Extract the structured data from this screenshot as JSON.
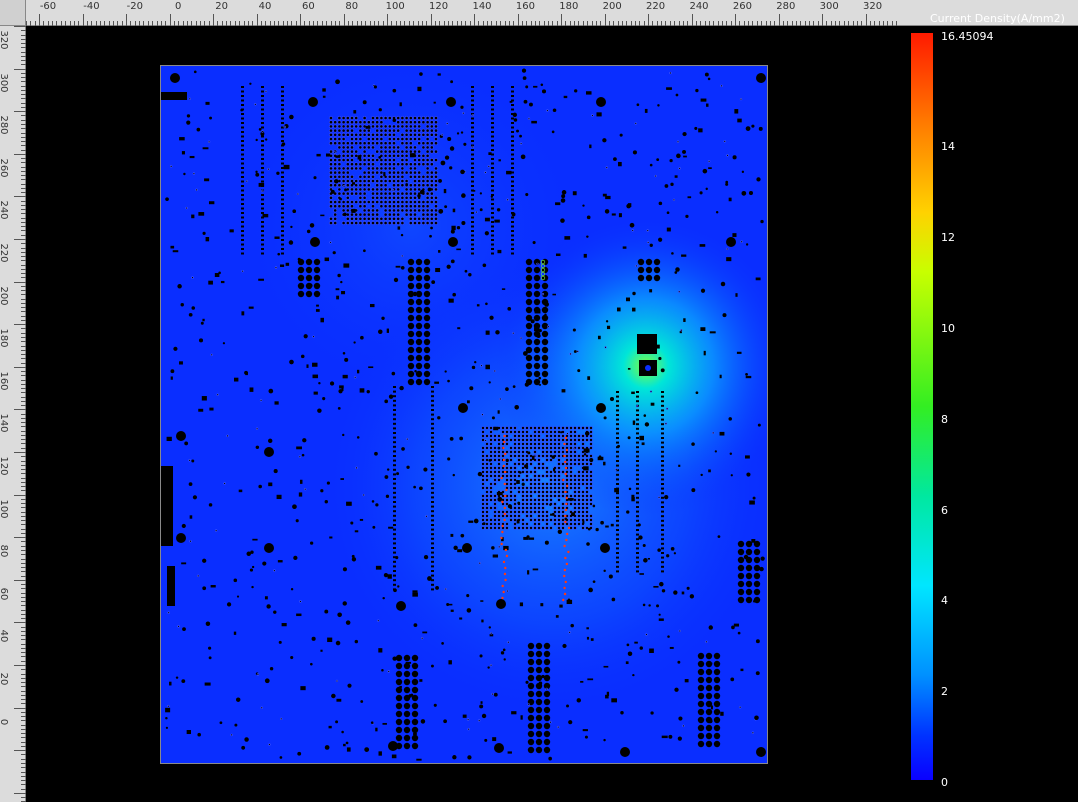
{
  "ruler": {
    "top_labels": [
      "-60",
      "-40",
      "-20",
      "0",
      "20",
      "40",
      "60",
      "80",
      "100",
      "120",
      "140",
      "160",
      "180",
      "200",
      "220",
      "240",
      "260",
      "280",
      "300",
      "320"
    ],
    "left_labels": [
      "320",
      "300",
      "280",
      "260",
      "240",
      "220",
      "200",
      "180",
      "160",
      "140",
      "120",
      "100",
      "80",
      "60",
      "40",
      "20",
      "0"
    ]
  },
  "legend": {
    "title": "Current Density(A/mm2)",
    "max_label": "16.45094",
    "ticks": [
      "14",
      "12",
      "10",
      "8",
      "6",
      "4",
      "2",
      "0"
    ]
  },
  "colors": {
    "board_base": "#0a2eff",
    "hotspot": "#00e6ff",
    "background": "#000000",
    "ruler": "#dcdcdc"
  },
  "icons": {
    "board": "pcb-board-icon"
  }
}
